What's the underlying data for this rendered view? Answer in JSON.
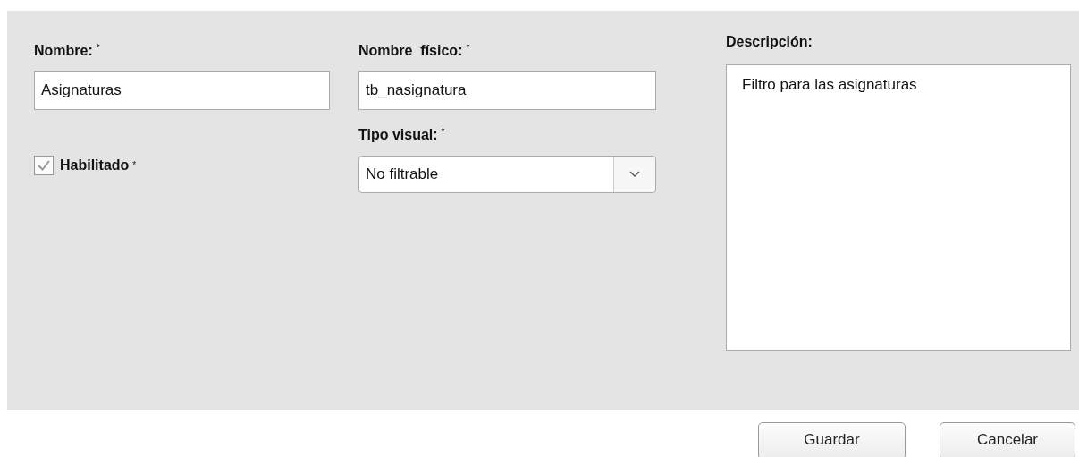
{
  "form": {
    "nombre": {
      "label": "Nombre:",
      "required_mark": "*",
      "value": "Asignaturas"
    },
    "habilitado": {
      "label": "Habilitado",
      "required_mark": "*",
      "checked": true
    },
    "nombre_fisico": {
      "label": "Nombre  físico:",
      "required_mark": "*",
      "value": "tb_nasignatura"
    },
    "tipo_visual": {
      "label": "Tipo visual:",
      "required_mark": "*",
      "value": "No filtrable"
    },
    "descripcion": {
      "label": "Descripción:",
      "value": "Filtro para las asignaturas"
    }
  },
  "buttons": [
    "Guardar",
    "Cancelar"
  ]
}
